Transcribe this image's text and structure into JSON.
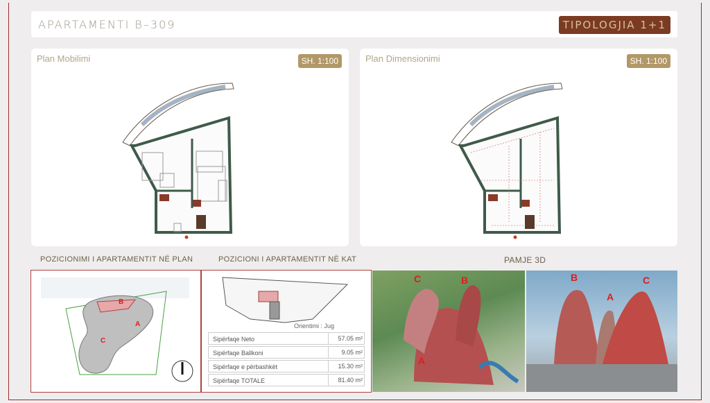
{
  "header": {
    "title": "APARTAMENTI B–309",
    "typology": "TIPOLOGJIA 1+1"
  },
  "plan_furniture": {
    "title": "Plan Mobilimi",
    "scale": "SH. 1:100"
  },
  "plan_dimension": {
    "title": "Plan Dimensionimi",
    "scale": "SH. 1:100"
  },
  "sections": {
    "position_plan": "POZICIONIMI I APARTAMENTIT NË PLAN",
    "position_floor": "POZICIONI I APARTAMENTIT NË KAT",
    "view3d": "PAMJE 3D"
  },
  "orientation": {
    "label": "Orientimi :",
    "value": "Jug"
  },
  "areas": [
    {
      "label": "Sipërfaqe Neto",
      "value": "57.05 m²"
    },
    {
      "label": "Sipërfaqe Ballkoni",
      "value": "9.05 m²"
    },
    {
      "label": "Sipërfaqe e përbashkët",
      "value": "15.30 m²"
    },
    {
      "label": "Sipërfaqe TOTALE",
      "value": "81.40 m²"
    }
  ],
  "site_labels": {
    "a": "A",
    "b": "B",
    "c": "C"
  },
  "colors": {
    "accent": "#7b3b22",
    "scale_badge": "#b29866",
    "frame": "#b04040"
  }
}
